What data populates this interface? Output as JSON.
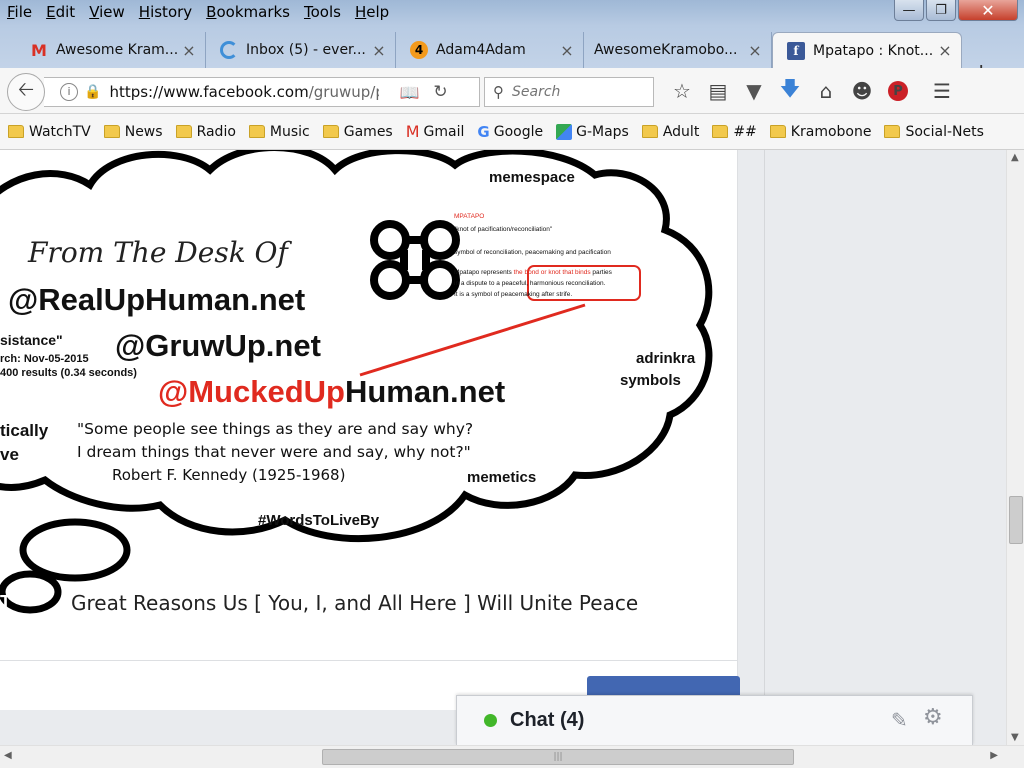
{
  "menu": [
    "File",
    "Edit",
    "View",
    "History",
    "Bookmarks",
    "Tools",
    "Help"
  ],
  "window": {
    "minimize": "—",
    "maximize": "❐",
    "close": "✕"
  },
  "tabs": [
    {
      "title": "Awesome Kram...",
      "icon": "gmail-icon"
    },
    {
      "title": "Inbox (5) - ever...",
      "icon": "inbox-icon"
    },
    {
      "title": "Adam4Adam",
      "icon": "four-icon"
    },
    {
      "title": "AwesomeKramobo...",
      "icon": "none"
    },
    {
      "title": "Mpatapo : Knot...",
      "icon": "facebook-icon",
      "active": true
    }
  ],
  "nav": {
    "url_host": "https://www.facebook.com",
    "url_path": "/gruwup/pos",
    "search_placeholder": "Search"
  },
  "bookmarks": [
    {
      "label": "WatchTV",
      "icon": "folder"
    },
    {
      "label": "News",
      "icon": "folder"
    },
    {
      "label": "Radio",
      "icon": "folder"
    },
    {
      "label": "Music",
      "icon": "folder"
    },
    {
      "label": "Games",
      "icon": "folder"
    },
    {
      "label": "Gmail",
      "icon": "gmail"
    },
    {
      "label": "Google",
      "icon": "google"
    },
    {
      "label": "G-Maps",
      "icon": "gmaps"
    },
    {
      "label": "Adult",
      "icon": "folder"
    },
    {
      "label": "##",
      "icon": "folder"
    },
    {
      "label": "Kramobone",
      "icon": "folder"
    },
    {
      "label": "Social-Nets",
      "icon": "folder"
    }
  ],
  "post_image": {
    "desk_heading": "From The Desk Of",
    "site1": "@RealUpHuman.net",
    "site2": "@GruwUp.net",
    "site3_red": "@MuckedUp",
    "site3_black": "Human.net",
    "left_fragment1": "sistance\"",
    "left_fragment2": "rch: Nov-05-2015",
    "left_fragment3": "400 results (0.34 seconds)",
    "left_fragment4": "tically",
    "left_fragment5": "ve",
    "quote_line1": "\"Some people see things as they are and say why?",
    "quote_line2": "I dream things that never were and say, why not?\"",
    "quote_author": "Robert F. Kennedy (1925-1968)",
    "label_memespace": "memespace",
    "label_adrinkra": "adrinkra",
    "label_symbols": "symbols",
    "label_memetics": "memetics",
    "hashtag": "#WordsToLiveBy",
    "bottom_line": "Great Reasons Us [ You, I, and All Here ] Will Unite Peace",
    "bottom_left_fragment": "T",
    "mpatapo_title": "MPATAPO",
    "mpatapo_sub": "\"knot of pacification/reconciliation\"",
    "mpatapo_desc1": "symbol of reconciliation, peacemaking and pacification",
    "mpatapo_desc2_a": "Mpatapo represents ",
    "mpatapo_desc2_red": "the bond or knot that binds",
    "mpatapo_desc2_b": " parties",
    "mpatapo_desc3": "in a dispute to a peaceful, harmonious reconciliation.",
    "mpatapo_desc4": "It is a symbol of peacemaking after strife."
  },
  "chat": {
    "label": "Chat (4)"
  },
  "colors": {
    "accent_red": "#e02a1f",
    "facebook_blue": "#4267b2",
    "online_green": "#42b72a"
  }
}
